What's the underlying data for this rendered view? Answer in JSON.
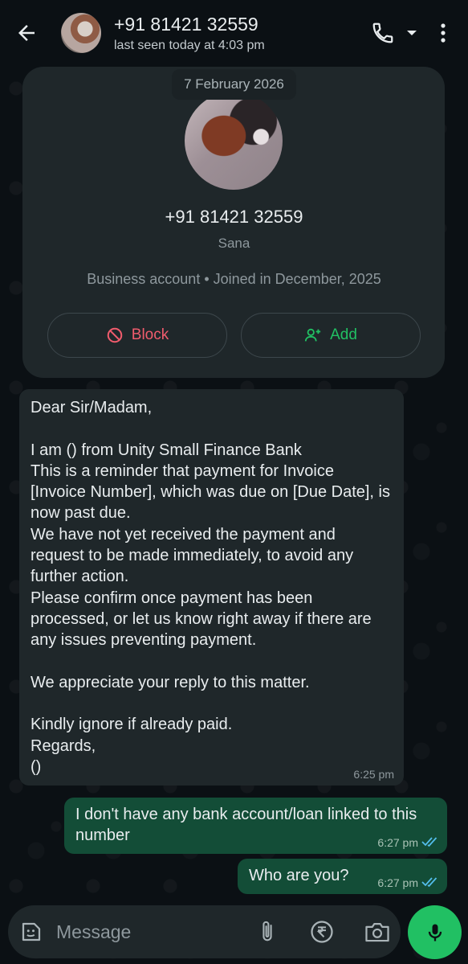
{
  "header": {
    "title": "+91 81421 32559",
    "subtitle": "last seen today at 4:03 pm",
    "icons": [
      "back-arrow-icon",
      "phone-icon",
      "chevron-down-icon",
      "more-vert-icon"
    ]
  },
  "date_chip": "7 February 2026",
  "profile": {
    "number": "+91 81421 32559",
    "name": "Sana",
    "info": "Business account • Joined in December, 2025",
    "block_label": "Block",
    "add_label": "Add"
  },
  "messages": [
    {
      "direction": "incoming",
      "text": "Dear Sir/Madam,\n\nI am () from Unity Small Finance Bank\nThis is a reminder that payment for Invoice [Invoice Number], which was due on [Due Date], is now past due.\nWe have not yet received the payment and request to be made immediately, to avoid any further action.\nPlease confirm once payment has been processed, or let us know right away if there are any issues preventing payment.\n\nWe appreciate your reply to this matter.\n\nKindly ignore if already paid.\nRegards,\n()",
      "time": "6:25 pm"
    },
    {
      "direction": "outgoing",
      "text": "I don't have any bank account/loan linked to this number",
      "time": "6:27 pm",
      "status": "read"
    },
    {
      "direction": "outgoing",
      "text": "Who are you?",
      "time": "6:27 pm",
      "status": "read"
    }
  ],
  "composer": {
    "placeholder": "Message",
    "icons": [
      "emoji-icon",
      "attach-icon",
      "rupee-icon",
      "camera-icon",
      "mic-icon"
    ]
  },
  "colors": {
    "accent": "#21c063",
    "danger": "#f15c6d",
    "incoming_bubble": "#1f272a",
    "outgoing_bubble": "#134d37",
    "read_ticks": "#53bdeb"
  }
}
